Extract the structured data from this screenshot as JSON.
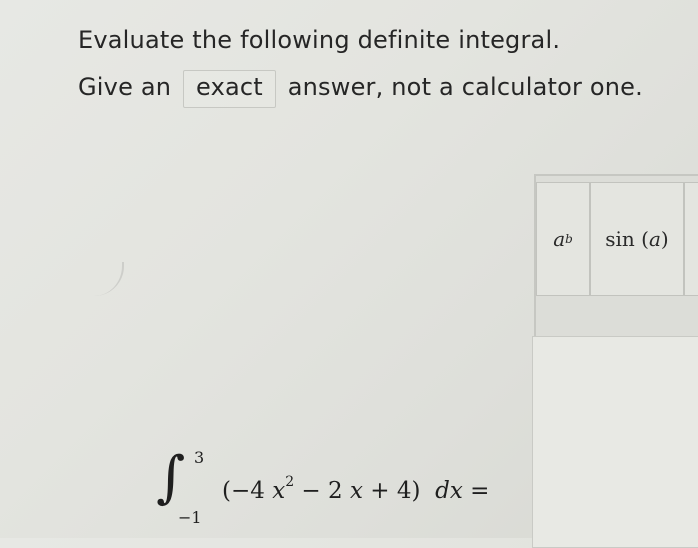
{
  "prompt": {
    "line1": "Evaluate the following definite integral.",
    "line2_before": "Give an",
    "line2_highlight": "exact",
    "line2_after": "answer, not a calculator one."
  },
  "integral": {
    "upper_limit": "3",
    "lower_limit": "−1",
    "integrand_open": "(−4",
    "var1": "x",
    "exponent": "2",
    "middle": "− 2",
    "var2": "x",
    "tail": "+ 4)",
    "differential_d": "d",
    "differential_var": "x",
    "equals": "="
  },
  "palette": {
    "power_base": "a",
    "power_exp": "b",
    "sin_func": "sin",
    "sin_open": "(",
    "sin_arg": "a",
    "sin_close": ")"
  },
  "answer": {
    "value": ""
  }
}
